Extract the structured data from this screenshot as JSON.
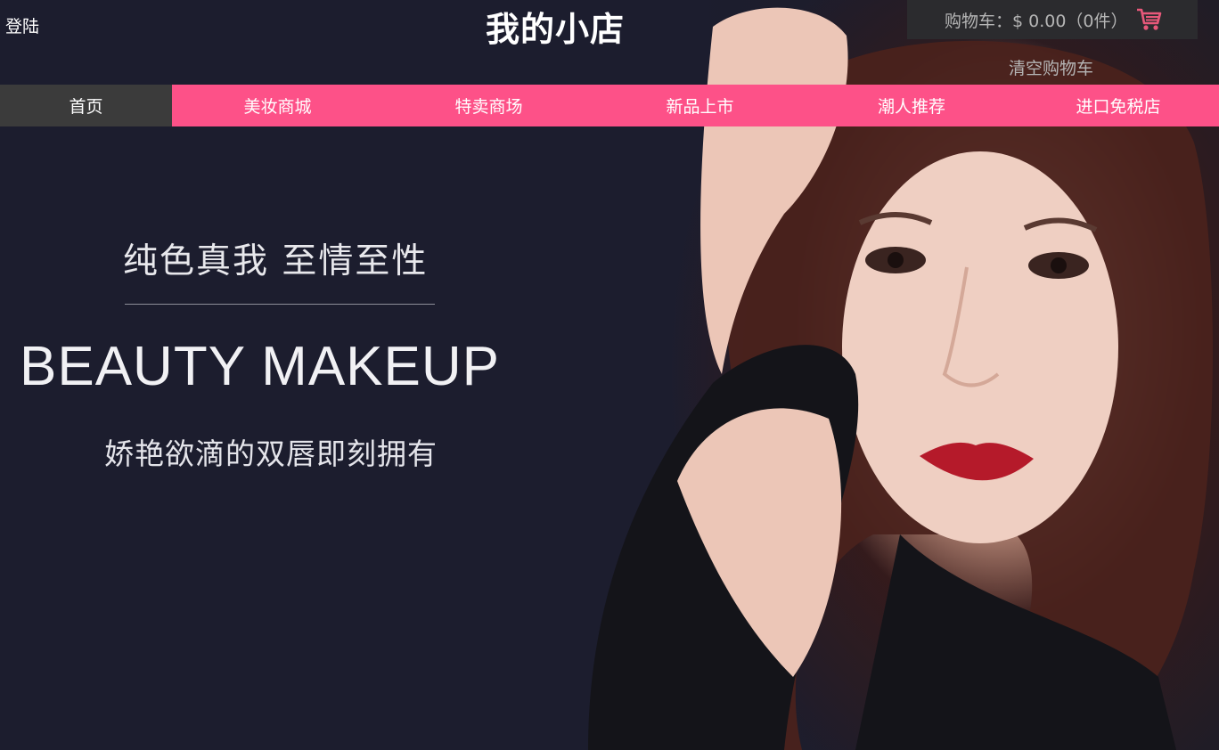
{
  "header": {
    "login_label": "登陆",
    "site_title": "我的小店",
    "cart_label": "购物车：$ 0.00（0件）",
    "clear_cart_label": "清空购物车"
  },
  "nav": {
    "items": [
      {
        "label": "首页",
        "active": true
      },
      {
        "label": "美妆商城"
      },
      {
        "label": "特卖商场"
      },
      {
        "label": "新品上市"
      },
      {
        "label": "潮人推荐"
      },
      {
        "label": "进口免税店"
      }
    ]
  },
  "banner": {
    "slogan_cn": "纯色真我 至情至性",
    "slogan_en": "BEAUTY MAKEUP",
    "slogan_sub": "娇艳欲滴的双唇即刻拥有"
  },
  "colors": {
    "nav_bg": "#fd5188",
    "nav_active_bg": "#3b3b3b",
    "page_bg": "#1c1d2e",
    "cart_bg": "#2b2b2e",
    "cart_icon": "#e8587a"
  },
  "icons": {
    "cart": "shopping-cart-icon"
  }
}
